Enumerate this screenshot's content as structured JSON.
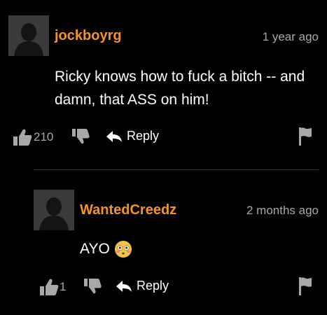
{
  "comments": [
    {
      "username": "jockboyrg",
      "time": "1 year ago",
      "lines": [
        "Ricky knows how to fuck a bitch -- and",
        "damn, that ASS on him!"
      ],
      "upvotes": "210",
      "reply_label": "Reply",
      "icons": [
        "avatar-silhouette-icon",
        "thumbs-up-icon",
        "thumbs-down-icon",
        "reply-arrow-icon",
        "flag-icon"
      ]
    },
    {
      "username": "WantedCreedz",
      "time": "2 months ago",
      "text": "AYO",
      "emoji": "😳",
      "upvotes": "1",
      "reply_label": "Reply",
      "icons": [
        "avatar-silhouette-icon",
        "thumbs-up-icon",
        "thumbs-down-icon",
        "reply-arrow-icon",
        "flag-icon"
      ]
    }
  ],
  "colors": {
    "background": "#000000",
    "username": "#f7931e",
    "meta": "#a8a8a8",
    "avatar": "#3a3a3a",
    "divider": "#333333"
  }
}
